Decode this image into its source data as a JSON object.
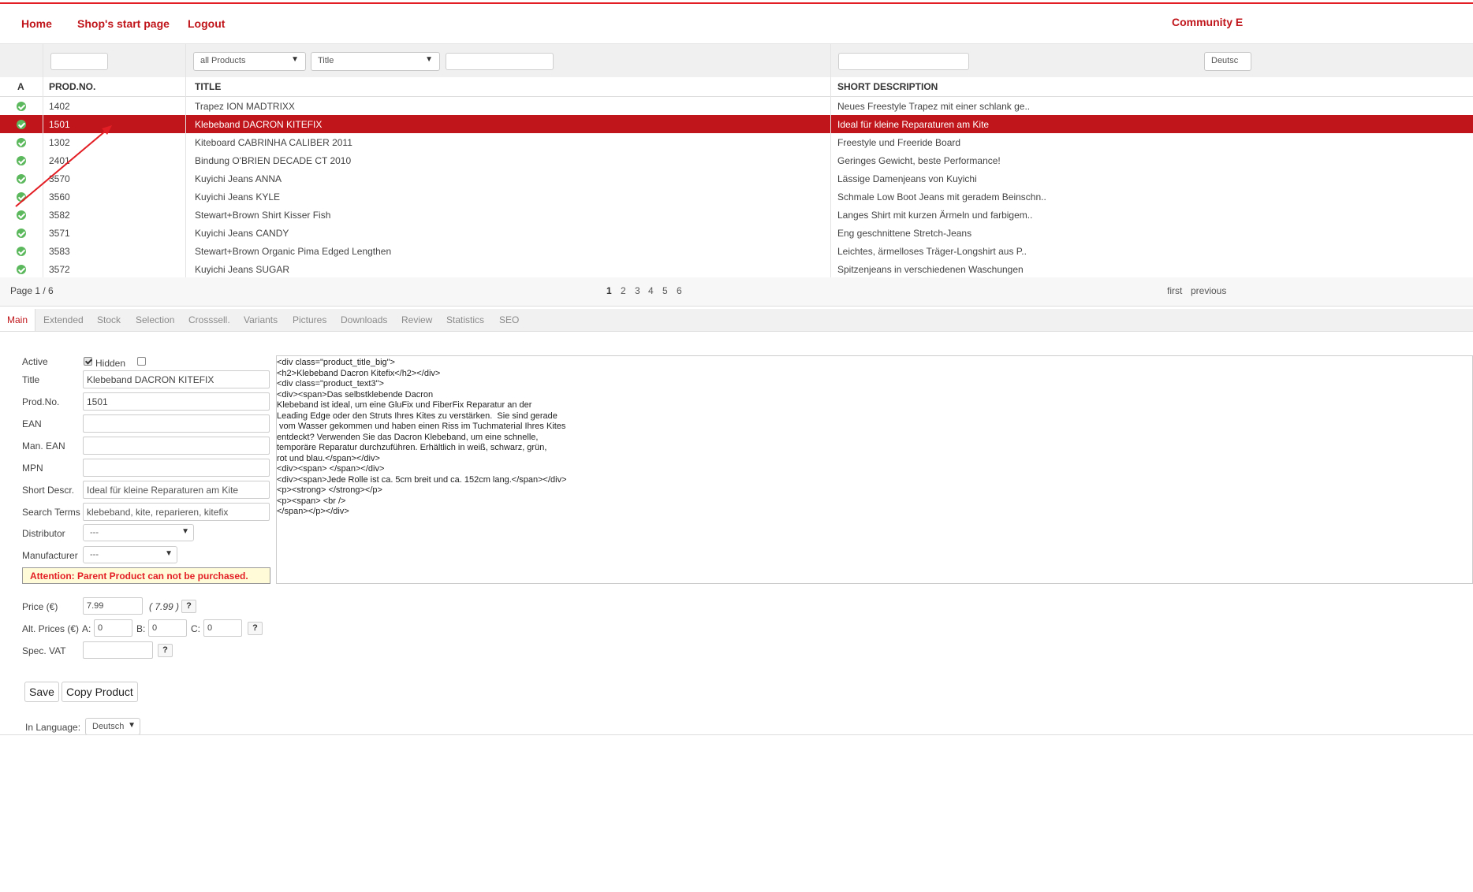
{
  "nav": {
    "home": "Home",
    "shop_start": "Shop's start page",
    "logout": "Logout",
    "community": "Community E"
  },
  "filters": {
    "prodno": "",
    "category": "all Products",
    "field": "Title",
    "search": "",
    "shortdesc": "",
    "language": "Deutsc"
  },
  "columns": {
    "active": "A",
    "prodno": "PROD.NO.",
    "title": "TITLE",
    "shortdesc": "SHORT DESCRIPTION"
  },
  "rows": [
    {
      "prodno": "1402",
      "title": "Trapez ION MADTRIXX",
      "shortdesc": "Neues Freestyle Trapez mit einer schlank ge.."
    },
    {
      "prodno": "1501",
      "title": "Klebeband DACRON KITEFIX",
      "shortdesc": "Ideal für kleine Reparaturen am Kite"
    },
    {
      "prodno": "1302",
      "title": "Kiteboard CABRINHA CALIBER 2011",
      "shortdesc": "Freestyle und Freeride Board"
    },
    {
      "prodno": "2401",
      "title": "Bindung O'BRIEN DECADE CT 2010",
      "shortdesc": "Geringes Gewicht, beste Performance!"
    },
    {
      "prodno": "3570",
      "title": "Kuyichi Jeans ANNA",
      "shortdesc": "Lässige Damenjeans von Kuyichi"
    },
    {
      "prodno": "3560",
      "title": "Kuyichi Jeans KYLE",
      "shortdesc": "Schmale Low Boot Jeans mit geradem Beinschn.."
    },
    {
      "prodno": "3582",
      "title": "Stewart+Brown Shirt Kisser Fish",
      "shortdesc": "Langes Shirt mit kurzen Ärmeln und farbigem.."
    },
    {
      "prodno": "3571",
      "title": "Kuyichi Jeans CANDY",
      "shortdesc": "Eng geschnittene Stretch-Jeans"
    },
    {
      "prodno": "3583",
      "title": "Stewart+Brown Organic Pima Edged Lengthen",
      "shortdesc": "Leichtes, ärmelloses Träger-Longshirt aus P.."
    },
    {
      "prodno": "3572",
      "title": "Kuyichi Jeans SUGAR",
      "shortdesc": "Spitzenjeans in verschiedenen Waschungen"
    }
  ],
  "pager": {
    "info": "Page 1 / 6",
    "pages": [
      "1",
      "2",
      "3",
      "4",
      "5",
      "6"
    ],
    "first": "first",
    "previous": "previous"
  },
  "tabs": [
    "Main",
    "Extended",
    "Stock",
    "Selection",
    "Crosssell.",
    "Variants",
    "Pictures",
    "Downloads",
    "Review",
    "Statistics",
    "SEO"
  ],
  "form": {
    "active_label": "Active",
    "hidden_label": "Hidden",
    "title_label": "Title",
    "title_value": "Klebeband DACRON KITEFIX",
    "prodno_label": "Prod.No.",
    "prodno_value": "1501",
    "ean_label": "EAN",
    "man_ean_label": "Man. EAN",
    "mpn_label": "MPN",
    "shortdesc_label": "Short Descr.",
    "shortdesc_value": "Ideal für kleine Reparaturen am Kite",
    "search_label": "Search Terms",
    "search_value": "klebeband, kite, reparieren, kitefix",
    "distributor_label": "Distributor",
    "distributor_value": "---",
    "manufacturer_label": "Manufacturer",
    "manufacturer_value": "---",
    "attention": "Attention: Parent Product can not be purchased.",
    "price_label": "Price (€)",
    "price_value": "7.99",
    "price_hint": "( 7.99 )",
    "alt_label": "Alt. Prices (€)",
    "a_label": "A:",
    "a_value": "0",
    "b_label": "B:",
    "b_value": "0",
    "c_label": "C:",
    "c_value": "0",
    "vat_label": "Spec. VAT",
    "vat_value": "",
    "help": "?",
    "save": "Save",
    "copy": "Copy Product",
    "lang_label": "In Language:",
    "lang_value": "Deutsch"
  },
  "editor": {
    "content": "<div class=\"product_title_big\">\n<h2>Klebeband Dacron Kitefix</h2></div>\n<div class=\"product_text3\">\n<div><span>Das selbstklebende Dacron\nKlebeband ist ideal, um eine GluFix und FiberFix Reparatur an der\nLeading Edge oder den Struts Ihres Kites zu verstärken.  Sie sind gerade\n vom Wasser gekommen und haben einen Riss im Tuchmaterial Ihres Kites\nentdeckt? Verwenden Sie das Dacron Klebeband, um eine schnelle,\ntemporäre Reparatur durchzuführen. Erhältlich in weiß, schwarz, grün,\nrot und blau.</span></div>\n<div><span> </span></div>\n<div><span>Jede Rolle ist ca. 5cm breit und ca. 152cm lang.</span></div>\n<p><strong> </strong></p>\n<p><span> <br />\n</span></p></div>"
  },
  "colors": {
    "brand": "#c0161b",
    "active_ok": "#5cb85c",
    "attention_bg": "#fffbd9"
  }
}
